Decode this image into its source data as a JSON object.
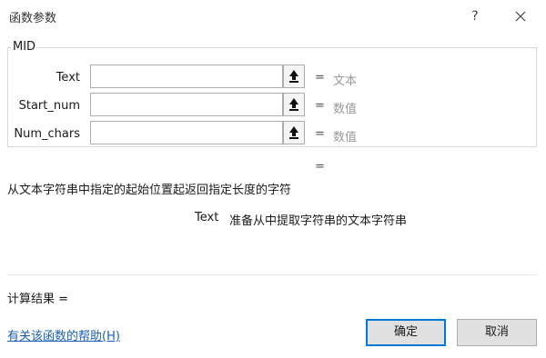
{
  "window": {
    "title": "函数参数",
    "help_label": "?",
    "close_icon": "close-icon"
  },
  "function": {
    "name": "MID",
    "arguments": [
      {
        "label": "Text",
        "value": "",
        "equals": "=",
        "type_hint": "文本"
      },
      {
        "label": "Start_num",
        "value": "",
        "equals": "=",
        "type_hint": "数值"
      },
      {
        "label": "Num_chars",
        "value": "",
        "equals": "=",
        "type_hint": "数值"
      }
    ],
    "result_equals": "=",
    "description": "从文本字符串中指定的起始位置起返回指定长度的字符",
    "current_param_name": "Text",
    "current_param_description": "准备从中提取字符串的文本字符串"
  },
  "footer": {
    "calc_result_label": "计算结果 =",
    "help_link": "有关该函数的帮助(H)",
    "ok_label": "确定",
    "cancel_label": "取消"
  },
  "colors": {
    "accent": "#0078d7",
    "link": "#1a5fb4",
    "hint_text": "#9a9a9a"
  }
}
